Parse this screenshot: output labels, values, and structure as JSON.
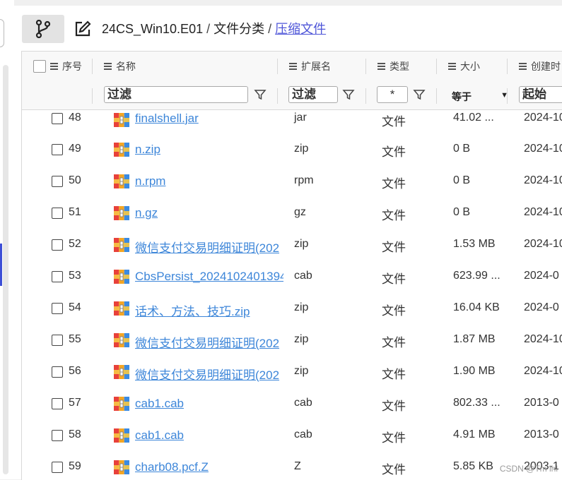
{
  "breadcrumb": {
    "root": "24CS_Win10.E01",
    "separator": "/",
    "folder": "文件分类",
    "current": "压缩文件"
  },
  "columns": {
    "seq": "序号",
    "name": "名称",
    "ext": "扩展名",
    "type": "类型",
    "size": "大小",
    "created": "创建时"
  },
  "filters": {
    "name_placeholder": "过滤",
    "ext_placeholder": "过滤",
    "type_value": "*",
    "size_operator": "等于",
    "created_placeholder": "起始"
  },
  "rows": [
    {
      "seq": "48",
      "name": "finalshell.jar",
      "ext": "jar",
      "type": "文件",
      "size": "41.02 ...",
      "created": "2024-10"
    },
    {
      "seq": "49",
      "name": "n.zip",
      "ext": "zip",
      "type": "文件",
      "size": "0 B",
      "created": "2024-10"
    },
    {
      "seq": "50",
      "name": "n.rpm",
      "ext": "rpm",
      "type": "文件",
      "size": "0 B",
      "created": "2024-10"
    },
    {
      "seq": "51",
      "name": "n.gz",
      "ext": "gz",
      "type": "文件",
      "size": "0 B",
      "created": "2024-10"
    },
    {
      "seq": "52",
      "name": "微信支付交易明细证明(202",
      "ext": "zip",
      "type": "文件",
      "size": "1.53 MB",
      "created": "2024-10"
    },
    {
      "seq": "53",
      "name": "CbsPersist_2024102401394",
      "ext": "cab",
      "type": "文件",
      "size": "623.99 ...",
      "created": "2024-0"
    },
    {
      "seq": "54",
      "name": "话术、方法、技巧.zip",
      "ext": "zip",
      "type": "文件",
      "size": "16.04 KB",
      "created": "2024-0"
    },
    {
      "seq": "55",
      "name": "微信支付交易明细证明(202",
      "ext": "zip",
      "type": "文件",
      "size": "1.87 MB",
      "created": "2024-10"
    },
    {
      "seq": "56",
      "name": "微信支付交易明细证明(202",
      "ext": "zip",
      "type": "文件",
      "size": "1.90 MB",
      "created": "2024-10"
    },
    {
      "seq": "57",
      "name": "cab1.cab",
      "ext": "cab",
      "type": "文件",
      "size": "802.33 ...",
      "created": "2013-0"
    },
    {
      "seq": "58",
      "name": "cab1.cab",
      "ext": "cab",
      "type": "文件",
      "size": "4.91 MB",
      "created": "2013-0"
    },
    {
      "seq": "59",
      "name": "charb08.pcf.Z",
      "ext": "Z",
      "type": "文件",
      "size": "5.85 KB",
      "created": "2003-1"
    }
  ],
  "watermark": "CSDN @Tm lhl",
  "colors": {
    "accent": "#4e55d8",
    "link": "#3d86d9",
    "header_bg": "#f8f8f8"
  }
}
